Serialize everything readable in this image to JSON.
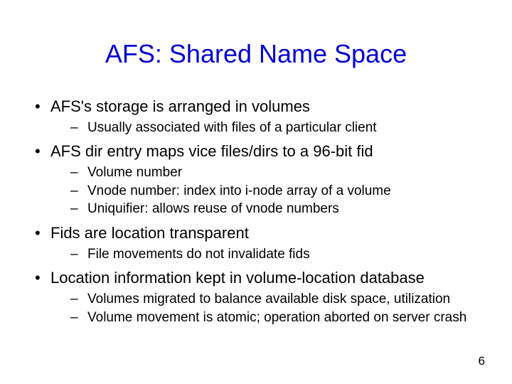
{
  "title": "AFS: Shared Name Space",
  "bullets": [
    {
      "text": "AFS's storage is arranged in volumes",
      "sub": [
        "Usually associated with files of a particular client"
      ]
    },
    {
      "text": "AFS dir entry maps vice files/dirs to a 96-bit fid",
      "sub": [
        "Volume number",
        "Vnode number: index into i-node array of a volume",
        "Uniquifier: allows reuse of vnode numbers"
      ]
    },
    {
      "text": "Fids are location transparent",
      "sub": [
        "File movements do not invalidate fids"
      ]
    },
    {
      "text": "Location information kept in volume-location database",
      "sub": [
        "Volumes migrated to balance available disk space, utilization",
        "Volume movement is atomic; operation aborted on server crash"
      ]
    }
  ],
  "page_number": "6"
}
